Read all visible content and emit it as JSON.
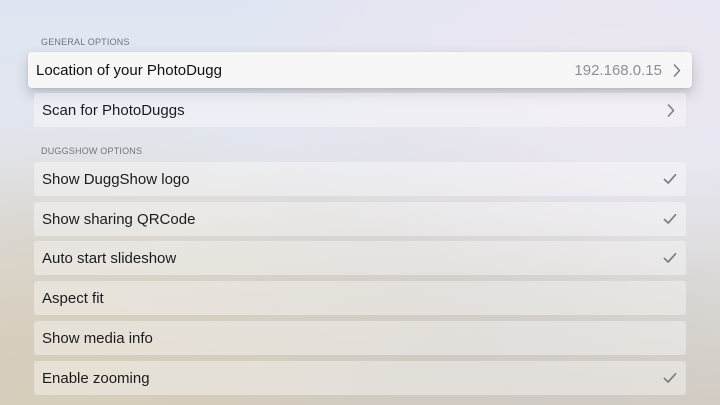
{
  "sections": {
    "general": {
      "header": "GENERAL OPTIONS",
      "location": {
        "label": "Location of your PhotoDugg",
        "value": "192.168.0.15",
        "icon": "chevron-right-icon"
      },
      "scan": {
        "label": "Scan for PhotoDuggs",
        "icon": "chevron-right-icon"
      }
    },
    "duggshow": {
      "header": "DUGGSHOW OPTIONS",
      "items": [
        {
          "label": "Show DuggShow logo",
          "checked": true
        },
        {
          "label": "Show sharing QRCode",
          "checked": true
        },
        {
          "label": "Auto start slideshow",
          "checked": true
        },
        {
          "label": "Aspect fit",
          "checked": false
        },
        {
          "label": "Show media info",
          "checked": false
        },
        {
          "label": "Enable zooming",
          "checked": true
        }
      ]
    }
  },
  "colors": {
    "text": "#1c1c1e",
    "secondary_text": "#8c8f95",
    "header_text": "#6f7580",
    "check_color": "#7d8087"
  }
}
